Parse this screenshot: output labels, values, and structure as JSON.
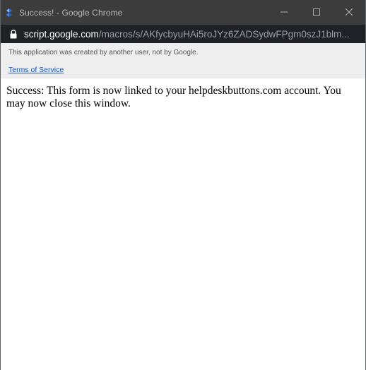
{
  "window": {
    "title": "Success! - Google Chrome",
    "app_icon": "apps-script-icon",
    "controls": {
      "minimize_icon": "minimize-icon",
      "maximize_icon": "maximize-icon",
      "close_icon": "close-icon"
    }
  },
  "address_bar": {
    "lock_icon": "lock-icon",
    "host": "script.google.com",
    "path": "/macros/s/AKfycbyuHAi5roJYz6ZADSydwFPgm0szJ1blm..."
  },
  "warning_bar": {
    "message": "This application was created by another user, not by Google.",
    "terms_link": "Terms of Service"
  },
  "content": {
    "message": "Success: This form is now linked to your helpdeskbuttons.com account. You may now close this window."
  },
  "colors": {
    "titlebar_bg": "#3c3c3c",
    "addressbar_bg": "#202124",
    "warning_bg": "#eeeeee",
    "link": "#1155cc"
  }
}
